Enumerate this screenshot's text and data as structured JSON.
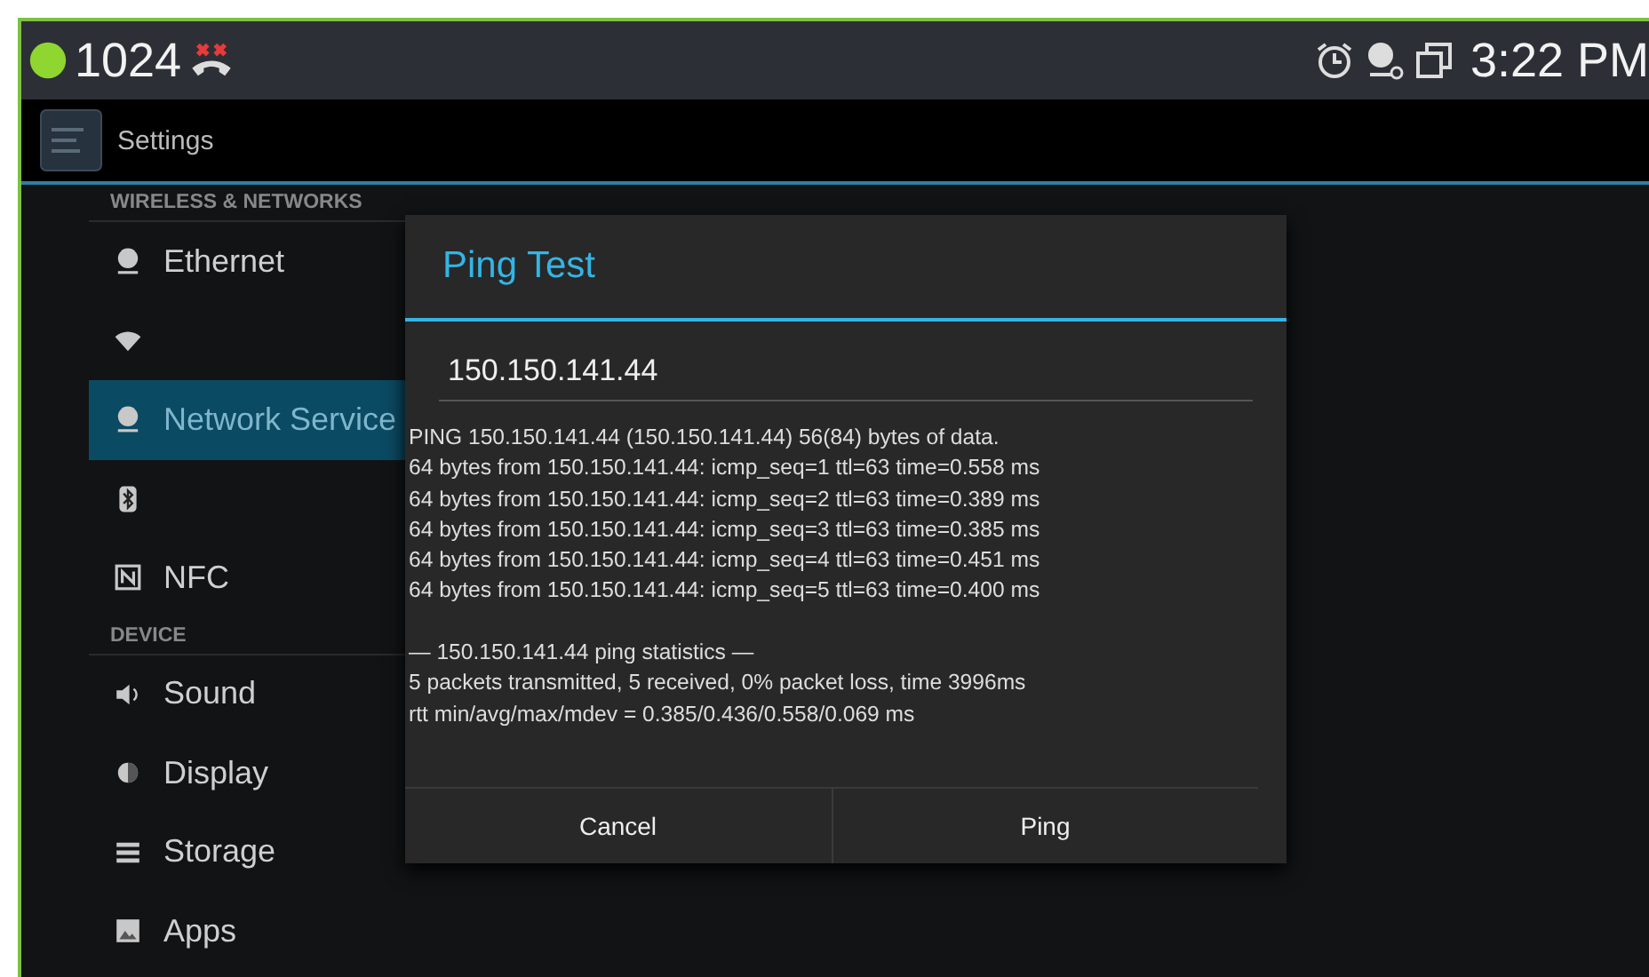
{
  "status_bar": {
    "extension": "1024",
    "time": "3:22 PM"
  },
  "action_bar": {
    "title": "Settings"
  },
  "settings_list": [
    {
      "kind": "header",
      "label": "WIRELESS & NETWORKS"
    },
    {
      "kind": "item",
      "label": "Ethernet",
      "selected": false
    },
    {
      "kind": "item",
      "selected": false
    },
    {
      "kind": "item",
      "label": "Network Service",
      "selected": true
    },
    {
      "kind": "item",
      "selected": false
    },
    {
      "kind": "item",
      "label": "NFC",
      "selected": false
    },
    {
      "kind": "header",
      "label": "DEVICE"
    },
    {
      "kind": "item",
      "label": "Sound",
      "selected": false
    },
    {
      "kind": "item",
      "label": "Display",
      "selected": false
    },
    {
      "kind": "item",
      "label": "Storage",
      "selected": false
    },
    {
      "kind": "item",
      "label": "Apps",
      "selected": false
    }
  ],
  "dialog": {
    "title": "Ping Test",
    "address": "150.150.141.44",
    "reply_lines": [
      "PING 150.150.141.44 (150.150.141.44) 56(84) bytes of data.",
      "64 bytes from 150.150.141.44: icmp_seq=1 ttl=63 time=0.558 ms",
      "64 bytes from 150.150.141.44: icmp_seq=2 ttl=63 time=0.389 ms",
      "64 bytes from 150.150.141.44: icmp_seq=3 ttl=63 time=0.385 ms",
      "64 bytes from 150.150.141.44: icmp_seq=4 ttl=63 time=0.451 ms",
      "64 bytes from 150.150.141.44: icmp_seq=5 ttl=63 time=0.400 ms"
    ],
    "statistics_lines": [
      "— 150.150.141.44 ping statistics —",
      "5 packets transmitted, 5 received, 0% packet loss, time 3996ms",
      "rtt min/avg/max/mdev = 0.385/0.436/0.558/0.069 ms"
    ],
    "buttons": [
      "Cancel",
      "Ping"
    ]
  }
}
